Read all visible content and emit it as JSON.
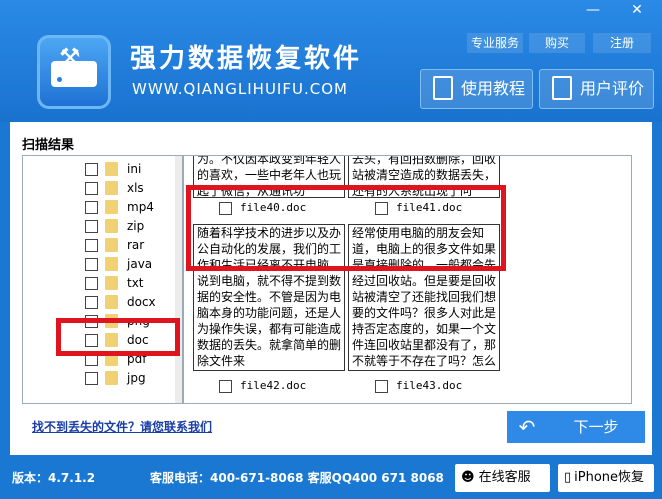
{
  "window": {
    "minimize": "—",
    "close": "✕"
  },
  "app": {
    "title": "强力数据恢复软件",
    "subtitle": "WWW.QIANGLIHUIFU.COM"
  },
  "toplinks": [
    "专业服务",
    "购买",
    "注册"
  ],
  "header_buttons": [
    {
      "label": "使用教程",
      "icon": "document-icon"
    },
    {
      "label": "用户评价",
      "icon": "chat-icon"
    }
  ],
  "panel": {
    "title": "扫描结果",
    "tree": [
      "ini",
      "xls",
      "mp4",
      "zip",
      "rar",
      "java",
      "txt",
      "docx",
      "png",
      "doc",
      "pdf",
      "jpg"
    ],
    "cards": [
      {
        "text": "为。不仅因本政变到年轻人的喜欢，一些中老年人也玩起了微信，从通讯功",
        "file": "file40.doc"
      },
      {
        "text": "去头，有回拍数删除，回收站被清空造成的数据丢失，还有的人系统出现了问",
        "file": "file41.doc"
      },
      {
        "text": "随着科学技术的进步以及办公自动化的发展，我们的工作和生活已经离不开电脑。说到电脑，就不得不提到数据的安全性。不管是因为电脑本身的功能问题，还是人为操作失误，都有可能造成数据的丢失。就拿简单的删除文件来",
        "file": "file42.doc"
      },
      {
        "text": "经常使用电脑的朋友会知道，电脑上的很多文件如果是直接删除的，一般都会先经过回收站。但是要是回收站被清空了还能找回我们想要的文件吗？很多人对此是持否定态度的，如果一个文件连回收站里都没有了，那不就等于不存在了吗？怎么还可",
        "file": "file43.doc"
      }
    ]
  },
  "actions": {
    "help_link": "找不到丢失的文件？请您联系我们",
    "back": "↶",
    "next": "下一步"
  },
  "footer": {
    "version": "版本：4.7.1.2",
    "hotline": "客服电话：400-671-8068 客服QQ400 671 8068",
    "online": "在线客服",
    "iphone": "iPhone恢复"
  }
}
